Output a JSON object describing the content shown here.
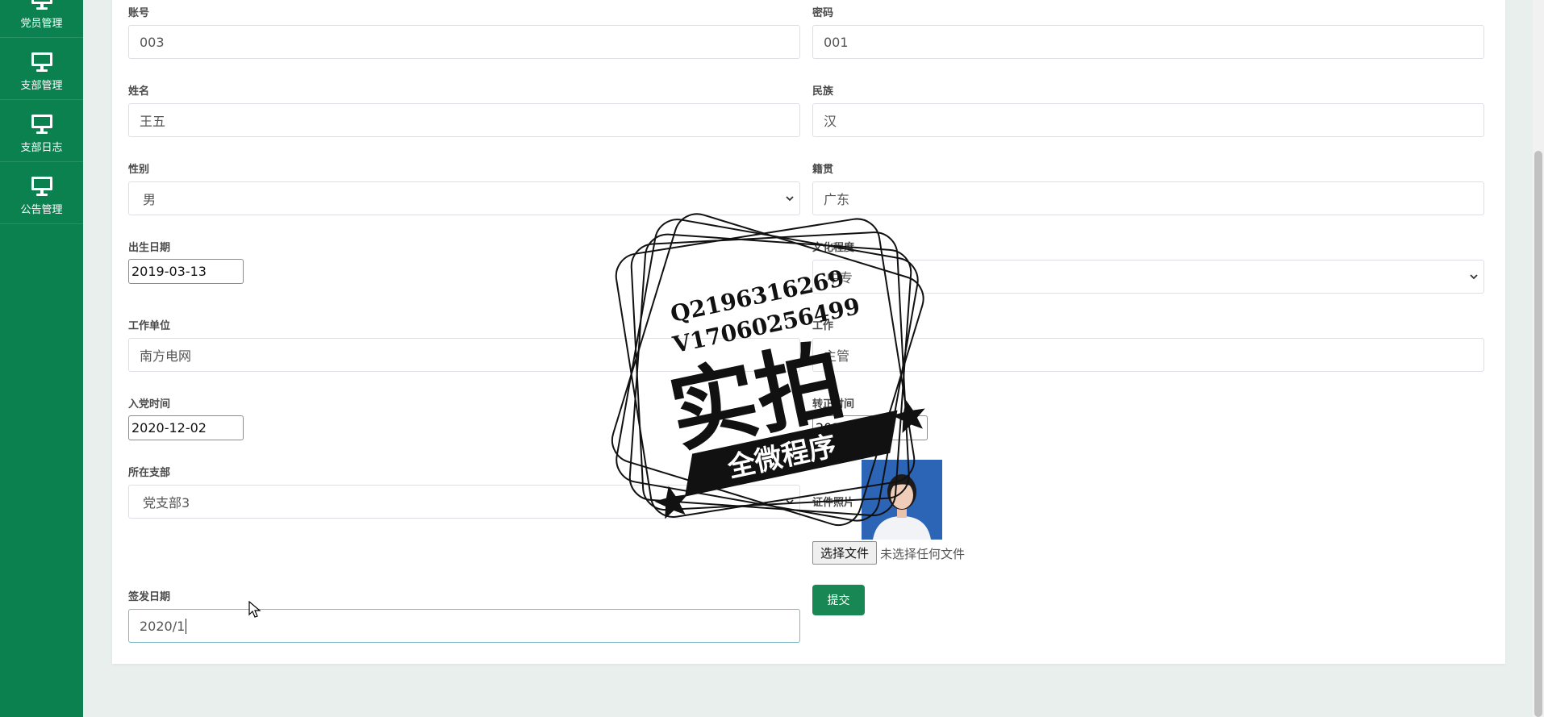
{
  "sidebar": {
    "items": [
      {
        "label": "党员管理",
        "icon": "monitor-icon"
      },
      {
        "label": "支部管理",
        "icon": "monitor-icon"
      },
      {
        "label": "支部日志",
        "icon": "monitor-icon"
      },
      {
        "label": "公告管理",
        "icon": "monitor-icon"
      }
    ],
    "color": "#0b8150"
  },
  "form": {
    "account": {
      "label": "账号",
      "value": "003"
    },
    "password": {
      "label": "密码",
      "value": "001"
    },
    "name": {
      "label": "姓名",
      "value": "王五"
    },
    "ethnicity": {
      "label": "民族",
      "value": "汉"
    },
    "gender": {
      "label": "性别",
      "value": "男"
    },
    "native_place": {
      "label": "籍贯",
      "value": "广东"
    },
    "birth_date": {
      "label": "出生日期",
      "value": "2019-03-13"
    },
    "education": {
      "label": "文化程度",
      "value": "中专"
    },
    "work_unit": {
      "label": "工作单位",
      "value": "南方电网"
    },
    "job": {
      "label": "工作",
      "value": "主管"
    },
    "join_date": {
      "label": "入党时间",
      "value": "2020-12-02"
    },
    "transfer_date": {
      "label": "转正时间",
      "value": "2020-11"
    },
    "branch": {
      "label": "所在支部",
      "value": "党支部3"
    },
    "photo": {
      "label": "证件照片",
      "choose_button": "选择文件",
      "status": "未选择任何文件"
    },
    "issue_date": {
      "label": "签发日期",
      "value": "2020/1"
    },
    "submit_label": "提交"
  },
  "watermark": {
    "line1": "Q2196316269",
    "line2": "V17060256499",
    "big_text": "实拍",
    "ribbon": "全微程序"
  },
  "colors": {
    "accent": "#198754",
    "page_bg": "#e8efec"
  }
}
